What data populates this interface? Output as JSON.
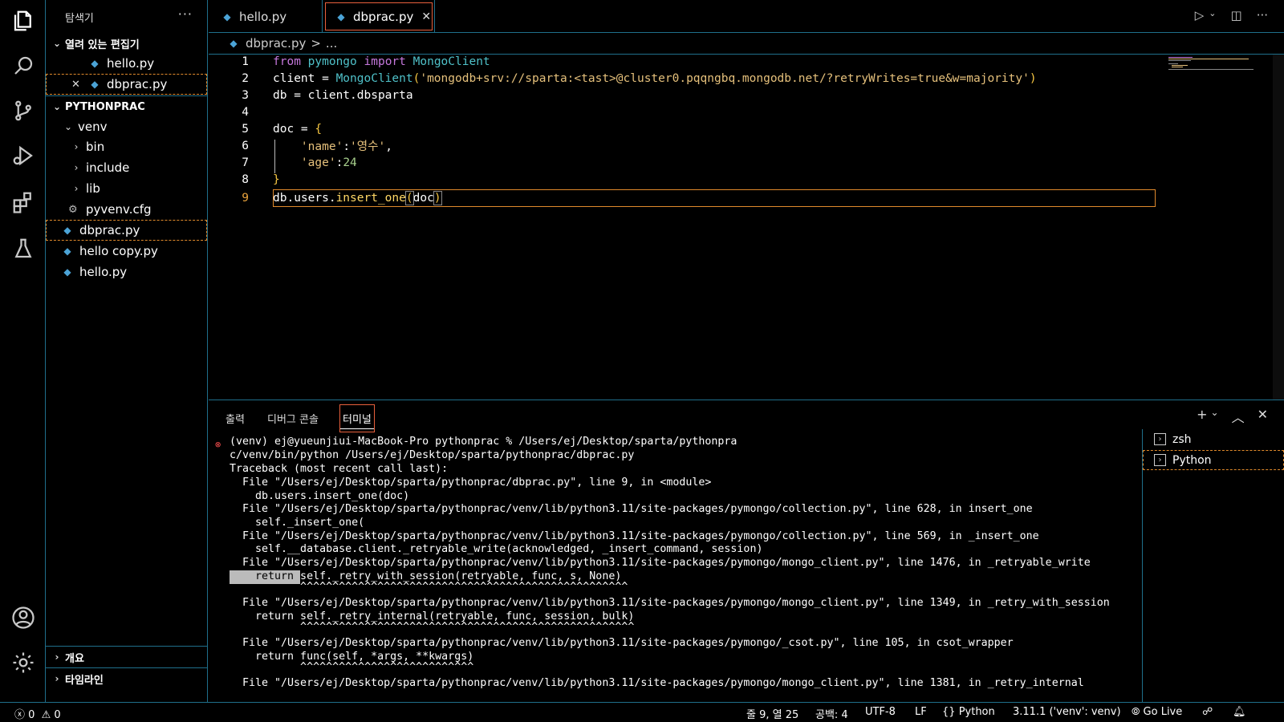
{
  "activity_bar": {
    "items": [
      "explorer-icon",
      "search-icon",
      "source-control-icon",
      "run-debug-icon",
      "extensions-icon",
      "testing-icon"
    ],
    "bottom": [
      "account-icon",
      "settings-gear-icon"
    ]
  },
  "sidebar": {
    "title": "탐색기",
    "more": "···",
    "open_editors": {
      "label": "열려 있는 편집기",
      "items": [
        "hello.py",
        "dbprac.py"
      ]
    },
    "project": {
      "label": "PYTHONPRAC",
      "venv": "venv",
      "venv_children": [
        "bin",
        "include",
        "lib"
      ],
      "cfg": "pyvenv.cfg",
      "files": [
        "dbprac.py",
        "hello copy.py",
        "hello.py"
      ]
    },
    "outline": "개요",
    "timeline": "타임라인"
  },
  "tabs": [
    {
      "label": "hello.py"
    },
    {
      "label": "dbprac.py",
      "close": "✕"
    }
  ],
  "breadcrumb": {
    "file": "dbprac.py",
    "sep": ">",
    "rest": "..."
  },
  "editor": {
    "lines": [
      {
        "n": "1"
      },
      {
        "n": "2"
      },
      {
        "n": "3"
      },
      {
        "n": "4"
      },
      {
        "n": "5"
      },
      {
        "n": "6"
      },
      {
        "n": "7"
      },
      {
        "n": "8"
      },
      {
        "n": "9"
      }
    ],
    "code": {
      "l1_from": "from",
      "l1_mod": "pymongo",
      "l1_import": "import",
      "l1_cls": "MongoClient",
      "l2_var": "client = ",
      "l2_cls": "MongoClient",
      "l2_open": "(",
      "l2_str": "'mongodb+srv://sparta:<tast>@cluster0.pqqngbq.mongodb.net/?retryWrites=true&w=majority'",
      "l2_close": ")",
      "l3": "db = client.dbsparta",
      "l5_var": "doc = ",
      "l5_brace": "{",
      "l6_key": "'name'",
      "l6_colon": ":",
      "l6_val": "'영수'",
      "l6_comma": ",",
      "l7_key": "'age'",
      "l7_colon": ":",
      "l7_val": "24",
      "l8": "}",
      "l9_obj": "db.users.",
      "l9_fn": "insert_one",
      "l9_open": "(",
      "l9_arg": "doc",
      "l9_close": ")"
    }
  },
  "panel": {
    "tabs": [
      "출력",
      "디버그 콘솔",
      "터미널"
    ],
    "actions": [
      "+",
      "⌄",
      "︿",
      "✕"
    ],
    "terminal_lines": [
      "(venv) ej@yueunjiui-MacBook-Pro pythonprac % /Users/ej/Desktop/sparta/pythonpra",
      "c/venv/bin/python /Users/ej/Desktop/sparta/pythonprac/dbprac.py",
      "Traceback (most recent call last):",
      "  File \"/Users/ej/Desktop/sparta/pythonprac/dbprac.py\", line 9, in <module>",
      "    db.users.insert_one(doc)",
      "  File \"/Users/ej/Desktop/sparta/pythonprac/venv/lib/python3.11/site-packages/pymongo/collection.py\", line 628, in insert_one",
      "    self._insert_one(",
      "  File \"/Users/ej/Desktop/sparta/pythonprac/venv/lib/python3.11/site-packages/pymongo/collection.py\", line 569, in _insert_one",
      "    self.__database.client._retryable_write(acknowledged, _insert_command, session)",
      "  File \"/Users/ej/Desktop/sparta/pythonprac/venv/lib/python3.11/site-packages/pymongo/mongo_client.py\", line 1476, in _retryable_write",
      "           self._retry_with_session(retryable, func, s, None)",
      "           ^^^^^^^^^^^^^^^^^^^^^^^^^^^^^^^^^^^^^^^^^^^^^^^^^^^",
      "",
      "  File \"/Users/ej/Desktop/sparta/pythonprac/venv/lib/python3.11/site-packages/pymongo/mongo_client.py\", line 1349, in _retry_with_session",
      "    return self._retry_internal(retryable, func, session, bulk)",
      "           ^^^^^^^^^^^^^^^^^^^^^^^^^^^^^^^^^^^^^^^^^^^^^^^^^^^^",
      "",
      "  File \"/Users/ej/Desktop/sparta/pythonprac/venv/lib/python3.11/site-packages/pymongo/_csot.py\", line 105, in csot_wrapper",
      "    return func(self, *args, **kwargs)",
      "           ^^^^^^^^^^^^^^^^^^^^^^^^^^^",
      "",
      "  File \"/Users/ej/Desktop/sparta/pythonprac/venv/lib/python3.11/site-packages/pymongo/mongo_client.py\", line 1381, in _retry_internal"
    ],
    "return_highlight": "    return ",
    "terminal_list": [
      "zsh",
      "Python"
    ]
  },
  "status": {
    "errors": "0",
    "warnings": "0",
    "position": "줄 9, 열 25",
    "spaces": "공백: 4",
    "encoding": "UTF-8",
    "eol": "LF",
    "language": "Python",
    "interpreter": "3.11.1 ('venv': venv)",
    "golive": "Go Live"
  }
}
